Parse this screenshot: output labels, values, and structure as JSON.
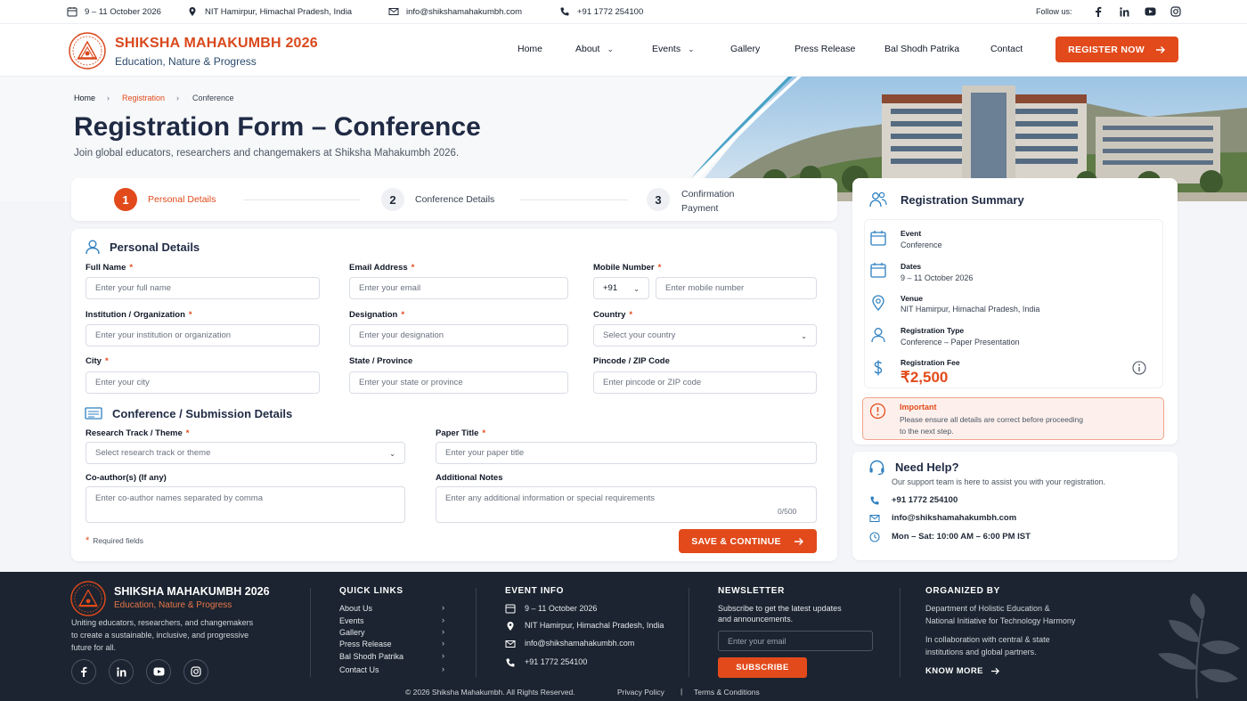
{
  "topbar": {
    "dates": "9 – 11 October 2026",
    "location": "NIT Hamirpur, Himachal Pradesh, India",
    "email": "info@shikshamahakumbh.com",
    "phone": "+91 1772 254100",
    "follow_label": "Follow us:"
  },
  "brand": {
    "title": "SHIKSHA MAHAKUMBH 2026",
    "subtitle": "Education, Nature & Progress",
    "accent_color": "#e24a1b"
  },
  "nav": {
    "items": [
      "Home",
      "About",
      "Events",
      "Gallery",
      "Press Release",
      "Bal Shodh Patrika",
      "Contact"
    ],
    "register_label": "REGISTER NOW"
  },
  "breadcrumb": [
    "Home",
    "Registration",
    "Conference"
  ],
  "page": {
    "title": "Registration Form – Conference",
    "subtitle": "Join global educators, researchers and changemakers at Shiksha Mahakumbh 2026."
  },
  "steps": [
    {
      "num": "1",
      "label": "Personal Details",
      "state": "active"
    },
    {
      "num": "2",
      "label": "Conference Details",
      "state": "pending"
    },
    {
      "num": "3",
      "label": "Confirmation",
      "label2": "Payment",
      "state": "pending"
    }
  ],
  "personal": {
    "title": "Personal Details",
    "fields": {
      "full_name": {
        "label": "Full Name",
        "placeholder": "Enter your full name"
      },
      "email": {
        "label": "Email Address",
        "placeholder": "Enter your email"
      },
      "mobile": {
        "label": "Mobile Number",
        "code": "+91",
        "placeholder": "Enter mobile number"
      },
      "institution": {
        "label": "Institution / Organization",
        "placeholder": "Enter your institution or organization"
      },
      "designation": {
        "label": "Designation",
        "placeholder": "Enter your designation"
      },
      "country": {
        "label": "Country",
        "placeholder": "Select your country"
      },
      "city": {
        "label": "City",
        "placeholder": "Enter your city"
      },
      "state": {
        "label": "State / Province",
        "placeholder": "Enter your state or province"
      },
      "pincode": {
        "label": "Pincode / ZIP Code",
        "placeholder": "Enter pincode or ZIP code"
      }
    }
  },
  "conference": {
    "title": "Conference / Submission Details",
    "fields": {
      "track": {
        "label": "Research Track / Theme",
        "placeholder": "Select research track or theme"
      },
      "paper_title": {
        "label": "Paper Title",
        "placeholder": "Enter your paper title"
      },
      "coauthors": {
        "label": "Co-author(s) (If any)",
        "placeholder": "Enter co-author names separated by comma"
      },
      "notes": {
        "label": "Additional Notes",
        "placeholder": "Enter any additional information or special requirements",
        "counter": "0/500"
      }
    },
    "required_note": "Required fields",
    "save_label": "SAVE & CONTINUE"
  },
  "summary": {
    "title": "Registration Summary",
    "rows": [
      {
        "title": "Event",
        "value": "Conference"
      },
      {
        "title": "Dates",
        "value": "9 – 11 October 2026"
      },
      {
        "title": "Venue",
        "value": "NIT Hamirpur, Himachal Pradesh, India"
      },
      {
        "title": "Registration Type",
        "value": "Conference – Paper Presentation"
      },
      {
        "title": "Registration Fee",
        "value": "₹2,500"
      }
    ],
    "important_title": "Important",
    "important_text1": "Please ensure all details are correct before proceeding",
    "important_text2": "to the next step."
  },
  "help": {
    "title": "Need Help?",
    "text": "Our support team is here to assist you with your registration.",
    "phone": "+91 1772 254100",
    "email": "info@shikshamahakumbh.com",
    "hours": "Mon – Sat: 10:00 AM – 6:00 PM IST"
  },
  "footer": {
    "brand_title": "SHIKSHA MAHAKUMBH 2026",
    "brand_sub": "Education, Nature & Progress",
    "about_lines": [
      "Uniting educators, researchers, and changemakers",
      "to create a sustainable, inclusive, and progressive",
      "future for all."
    ],
    "quick_title": "QUICK LINKS",
    "quick_links": [
      "About Us",
      "Events",
      "Gallery",
      "Press Release",
      "Bal Shodh Patrika",
      "Contact Us"
    ],
    "event_title": "EVENT INFO",
    "event_dates": "9 – 11 October 2026",
    "event_location": "NIT Hamirpur, Himachal Pradesh, India",
    "event_email": "info@shikshamahakumbh.com",
    "event_phone": "+91 1772 254100",
    "news_title": "NEWSLETTER",
    "news_text1": "Subscribe to get the latest updates",
    "news_text2": "and announcements.",
    "news_placeholder": "Enter your email",
    "subscribe_label": "SUBSCRIBE",
    "org_title": "ORGANIZED BY",
    "org_lines": [
      "Department of Holistic Education &",
      "National Initiative for Technology Harmony"
    ],
    "collab_lines": [
      "In collaboration with central & state",
      "institutions and global partners."
    ],
    "know_more": "KNOW MORE",
    "copyright": "© 2026 Shiksha Mahakumbh. All Rights Reserved.",
    "privacy": "Privacy Policy",
    "terms": "Terms & Conditions"
  }
}
